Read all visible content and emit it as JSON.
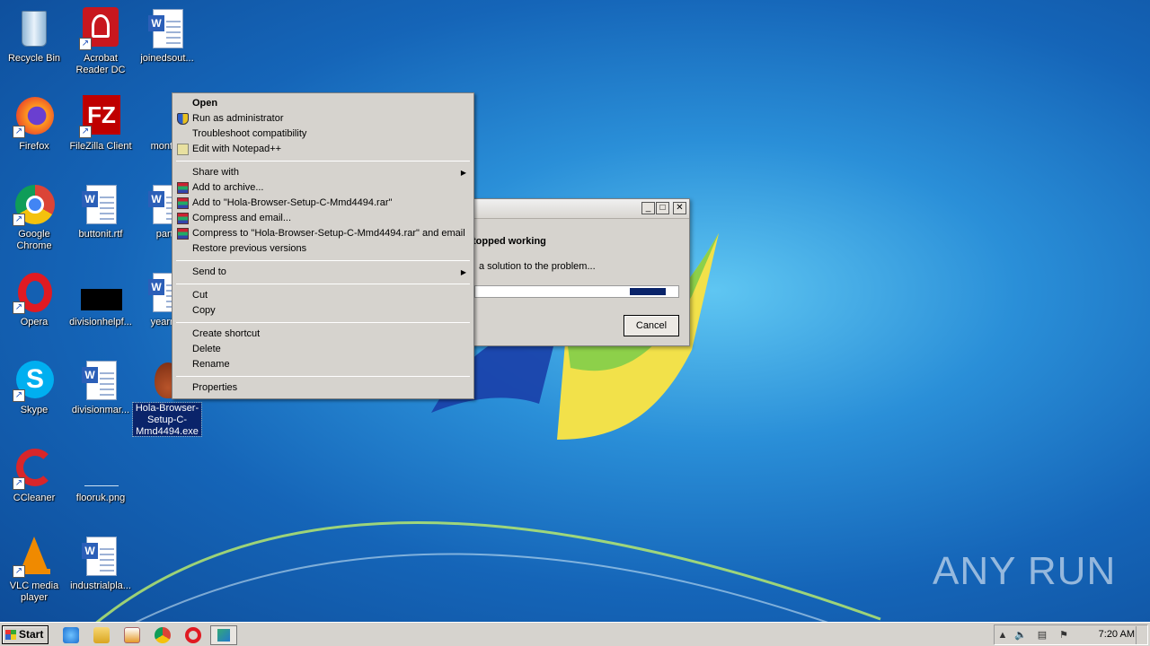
{
  "desktop": {
    "icons": [
      {
        "label": "Recycle Bin"
      },
      {
        "label": "Acrobat Reader DC"
      },
      {
        "label": "joinedsout..."
      },
      {
        "label": "Firefox"
      },
      {
        "label": "FileZilla Client"
      },
      {
        "label": "monthe"
      },
      {
        "label": "Google Chrome"
      },
      {
        "label": "buttonit.rtf"
      },
      {
        "label": "partc"
      },
      {
        "label": "Opera"
      },
      {
        "label": "divisionhelpf..."
      },
      {
        "label": "yearnot"
      },
      {
        "label": "Skype"
      },
      {
        "label": "divisionmar..."
      },
      {
        "label": "Hola-Browser-Setup-C-Mmd4494.exe"
      },
      {
        "label": "CCleaner"
      },
      {
        "label": "flooruk.png"
      },
      {
        "label": "VLC media player"
      },
      {
        "label": "industrialpla..."
      }
    ]
  },
  "dialog": {
    "heading": "topped working",
    "message": "a solution to the problem...",
    "progress": 0.17,
    "cancel_label": "Cancel"
  },
  "context_menu": {
    "items": [
      {
        "label": "Open"
      },
      {
        "label": "Run as administrator"
      },
      {
        "label": "Troubleshoot compatibility"
      },
      {
        "label": "Edit with Notepad++"
      },
      {
        "label": "Share with"
      },
      {
        "label": "Add to archive..."
      },
      {
        "label": "Add to \"Hola-Browser-Setup-C-Mmd4494.rar\""
      },
      {
        "label": "Compress and email..."
      },
      {
        "label": "Compress to \"Hola-Browser-Setup-C-Mmd4494.rar\" and email"
      },
      {
        "label": "Restore previous versions"
      },
      {
        "label": "Send to"
      },
      {
        "label": "Cut"
      },
      {
        "label": "Copy"
      },
      {
        "label": "Create shortcut"
      },
      {
        "label": "Delete"
      },
      {
        "label": "Rename"
      },
      {
        "label": "Properties"
      }
    ]
  },
  "taskbar": {
    "start_label": "Start",
    "clock": "7:20 AM"
  },
  "watermark": "ANY RUN",
  "colors": {
    "selection": "#0a246a",
    "menu_bg": "#d6d3ce",
    "desktop_blue": "#1565b8"
  }
}
